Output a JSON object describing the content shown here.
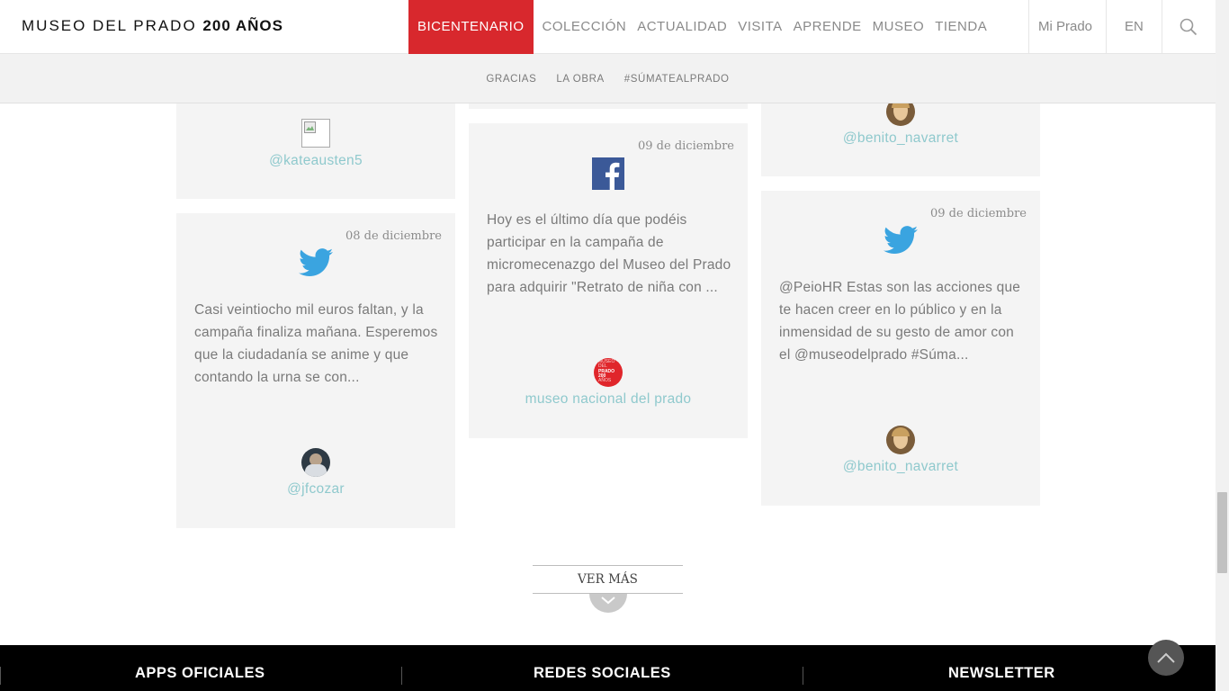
{
  "header": {
    "brand_name": "MUSEO DEL PRADO",
    "brand_bold": "200 AÑOS",
    "nav": [
      "BICENTENARIO",
      "COLECCIÓN",
      "ACTUALIDAD",
      "VISITA",
      "APRENDE",
      "MUSEO",
      "TIENDA"
    ],
    "mi_prado": "Mi Prado",
    "lang": "EN",
    "accent_color": "#d8282d"
  },
  "subnav": [
    "GRACIAS",
    "LA OBRA",
    "#SÚMATEALPRADO"
  ],
  "cards": {
    "kate": {
      "author": "@kateausten5"
    },
    "jfcozar": {
      "date": "08 de diciembre",
      "network": "twitter",
      "text": "Casi veintiocho mil euros faltan, y la campaña finaliza mañana. Esperemos que la ciudadanía se anime y que contando la urna se con...",
      "author": "@jfcozar"
    },
    "museo": {
      "date": "09 de diciembre",
      "network": "facebook",
      "text": "Hoy es el último día que podéis participar en la campaña de micromecenazgo del Museo del Prado para adquirir \"Retrato de niña con ...",
      "author": "museo nacional del prado",
      "avatar_lines": [
        "MUSEO",
        "DEL",
        "PRADO",
        "200",
        "AÑOS"
      ]
    },
    "benito_top": {
      "author": "@benito_navarret"
    },
    "benito": {
      "date": "09 de diciembre",
      "network": "twitter",
      "text": "@PeioHR Estas son las acciones que te hacen creer en lo público y en la inmensidad de su gesto de amor con el @museodelprado #Súma...",
      "author": "@benito_navarret"
    }
  },
  "ver_mas": "VER MÁS",
  "footer": [
    "APPS OFICIALES",
    "REDES SOCIALES",
    "NEWSLETTER"
  ]
}
